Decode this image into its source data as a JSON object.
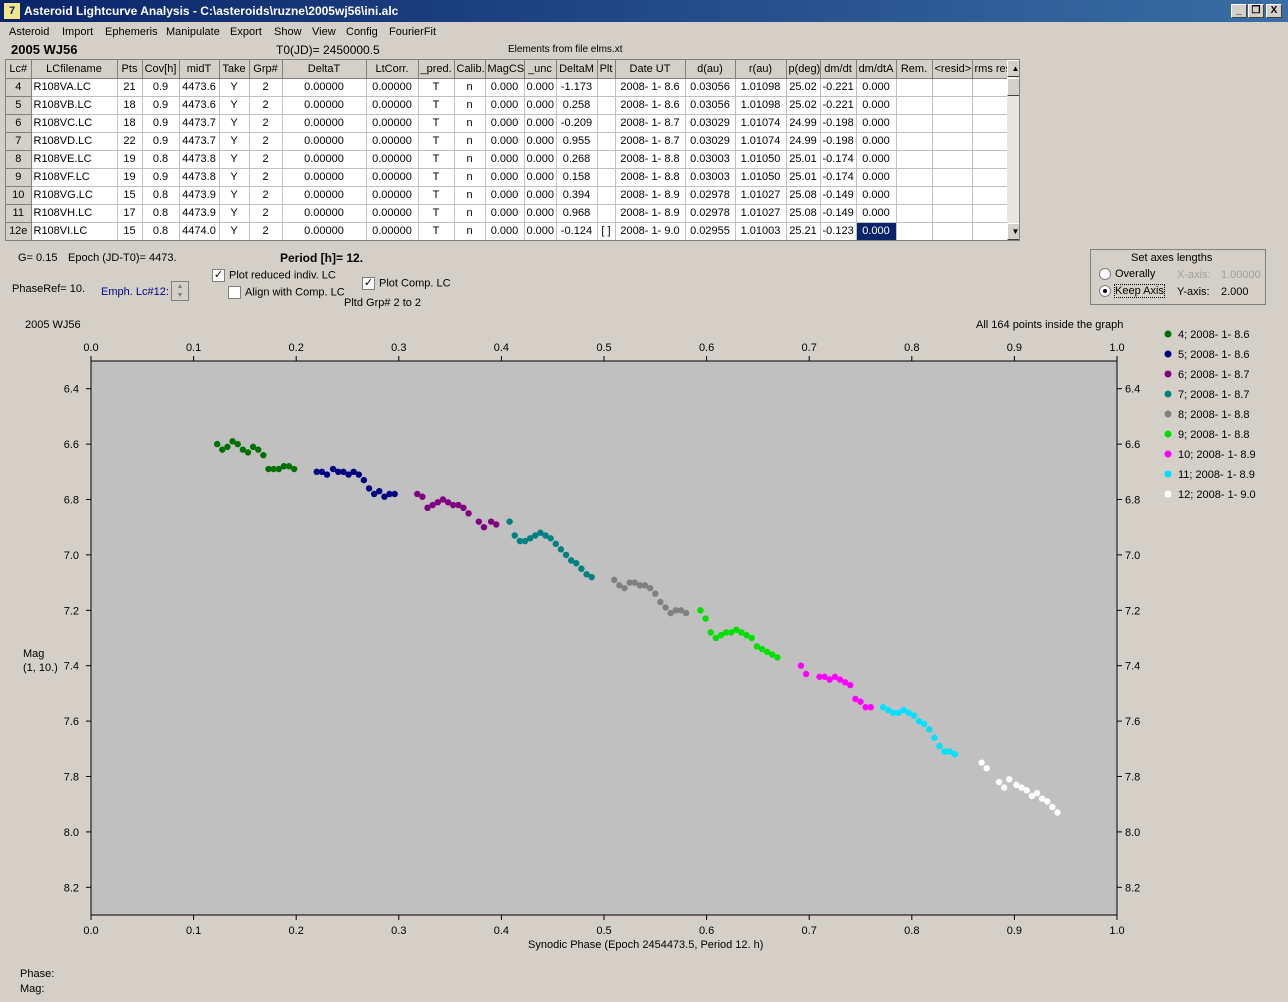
{
  "window": {
    "title": "Asteroid Lightcurve Analysis - C:\\asteroids\\ruzne\\2005wj56\\ini.alc",
    "icon_glyph": "7",
    "controls": {
      "minimize": "_",
      "restore": "❐",
      "close": "X"
    }
  },
  "menu": [
    "Asteroid",
    "Import",
    "Ephemeris",
    "Manipulate",
    "Export",
    "Show",
    "View",
    "Config",
    "FourierFit"
  ],
  "header": {
    "asteroid_name": "2005 WJ56",
    "t0": "T0(JD)= 2450000.5",
    "elements": "Elements from file elms.xt"
  },
  "table": {
    "columns": [
      "Lc#",
      "LCfilename",
      "Pts",
      "Cov[h]",
      "midT",
      "Take",
      "Grp#",
      "DeltaT",
      "LtCorr.",
      "_pred.",
      "Calib.",
      "MagCS",
      "_unc",
      "DeltaM",
      "Plt",
      "Date UT",
      "d(au)",
      "r(au)",
      "p(deg)",
      "dm/dt",
      "dm/dtA",
      "Rem.",
      "<resid>",
      "rms res"
    ],
    "rows": [
      [
        "4",
        "R108VA.LC",
        "21",
        "0.9",
        "4473.6",
        "Y",
        "2",
        "0.00000",
        "0.00000",
        "T",
        "n",
        "0.000",
        "0.000",
        "-1.173",
        "",
        "2008- 1- 8.6",
        "0.03056",
        "1.01098",
        "25.02",
        "-0.221",
        "0.000",
        "",
        "",
        ""
      ],
      [
        "5",
        "R108VB.LC",
        "18",
        "0.9",
        "4473.6",
        "Y",
        "2",
        "0.00000",
        "0.00000",
        "T",
        "n",
        "0.000",
        "0.000",
        "0.258",
        "",
        "2008- 1- 8.6",
        "0.03056",
        "1.01098",
        "25.02",
        "-0.221",
        "0.000",
        "",
        "",
        ""
      ],
      [
        "6",
        "R108VC.LC",
        "18",
        "0.9",
        "4473.7",
        "Y",
        "2",
        "0.00000",
        "0.00000",
        "T",
        "n",
        "0.000",
        "0.000",
        "-0.209",
        "",
        "2008- 1- 8.7",
        "0.03029",
        "1.01074",
        "24.99",
        "-0.198",
        "0.000",
        "",
        "",
        ""
      ],
      [
        "7",
        "R108VD.LC",
        "22",
        "0.9",
        "4473.7",
        "Y",
        "2",
        "0.00000",
        "0.00000",
        "T",
        "n",
        "0.000",
        "0.000",
        "0.955",
        "",
        "2008- 1- 8.7",
        "0.03029",
        "1.01074",
        "24.99",
        "-0.198",
        "0.000",
        "",
        "",
        ""
      ],
      [
        "8",
        "R108VE.LC",
        "19",
        "0.8",
        "4473.8",
        "Y",
        "2",
        "0.00000",
        "0.00000",
        "T",
        "n",
        "0.000",
        "0.000",
        "0.268",
        "",
        "2008- 1- 8.8",
        "0.03003",
        "1.01050",
        "25.01",
        "-0.174",
        "0.000",
        "",
        "",
        ""
      ],
      [
        "9",
        "R108VF.LC",
        "19",
        "0.9",
        "4473.8",
        "Y",
        "2",
        "0.00000",
        "0.00000",
        "T",
        "n",
        "0.000",
        "0.000",
        "0.158",
        "",
        "2008- 1- 8.8",
        "0.03003",
        "1.01050",
        "25.01",
        "-0.174",
        "0.000",
        "",
        "",
        ""
      ],
      [
        "10",
        "R108VG.LC",
        "15",
        "0.8",
        "4473.9",
        "Y",
        "2",
        "0.00000",
        "0.00000",
        "T",
        "n",
        "0.000",
        "0.000",
        "0.394",
        "",
        "2008- 1- 8.9",
        "0.02978",
        "1.01027",
        "25.08",
        "-0.149",
        "0.000",
        "",
        "",
        ""
      ],
      [
        "11",
        "R108VH.LC",
        "17",
        "0.8",
        "4473.9",
        "Y",
        "2",
        "0.00000",
        "0.00000",
        "T",
        "n",
        "0.000",
        "0.000",
        "0.968",
        "",
        "2008- 1- 8.9",
        "0.02978",
        "1.01027",
        "25.08",
        "-0.149",
        "0.000",
        "",
        "",
        ""
      ],
      [
        "12e",
        "R108VI.LC",
        "15",
        "0.8",
        "4474.0",
        "Y",
        "2",
        "0.00000",
        "0.00000",
        "T",
        "n",
        "0.000",
        "0.000",
        "-0.124",
        "[ ]",
        "2008- 1- 9.0",
        "0.02955",
        "1.01003",
        "25.21",
        "-0.123",
        "0.000",
        "",
        "",
        ""
      ]
    ]
  },
  "controls": {
    "g_value": "G= 0.15",
    "epoch": "Epoch (JD-T0)= 4473.",
    "period": "Period [h]= 12.",
    "phase_ref": "PhaseRef= 10.",
    "emph": "Emph. Lc#12:",
    "plot_reduced": "Plot reduced indiv. LC",
    "align_comp": "Align with Comp. LC",
    "plot_comp": "Plot Comp. LC",
    "pltd_grp": "Pltd Grp#  2   to   2",
    "check_mark": "✓"
  },
  "axes_box": {
    "title": "Set axes lengths",
    "overally": "Overally",
    "keep_axis": "Keep Axis",
    "x_label": "X-axis:",
    "x_value": "1.00000",
    "y_label": "Y-axis:",
    "y_value": "2.000"
  },
  "graph": {
    "top_left": "2005 WJ56",
    "top_right": "All 164 points inside the graph",
    "ylabel_line1": "Mag",
    "ylabel_line2": "(1, 10.)",
    "xlabel": "Synodic Phase (Epoch 2454473.5, Period 12. h)"
  },
  "chart_data": {
    "type": "scatter",
    "xlim": [
      0,
      1
    ],
    "ylim": [
      8.3,
      6.3
    ],
    "y_inverted": true,
    "x_ticks": [
      0.0,
      0.1,
      0.2,
      0.3,
      0.4,
      0.5,
      0.6,
      0.7,
      0.8,
      0.9,
      1.0
    ],
    "y_ticks": [
      6.4,
      6.6,
      6.8,
      7.0,
      7.2,
      7.4,
      7.6,
      7.8,
      8.0,
      8.2
    ],
    "legend_position": "right",
    "series": [
      {
        "name": "4; 2008- 1- 8.6",
        "color": "#007000",
        "x": [
          0.123,
          0.128,
          0.133,
          0.138,
          0.143,
          0.148,
          0.153,
          0.158,
          0.163,
          0.168,
          0.173,
          0.178,
          0.183,
          0.188,
          0.193,
          0.198
        ],
        "y": [
          6.6,
          6.62,
          6.61,
          6.59,
          6.6,
          6.62,
          6.63,
          6.61,
          6.62,
          6.64,
          6.69,
          6.69,
          6.69,
          6.68,
          6.68,
          6.69
        ]
      },
      {
        "name": "5; 2008- 1- 8.6",
        "color": "#000080",
        "x": [
          0.22,
          0.225,
          0.23,
          0.236,
          0.241,
          0.246,
          0.251,
          0.256,
          0.261,
          0.266,
          0.271,
          0.276,
          0.281,
          0.286,
          0.291,
          0.296
        ],
        "y": [
          6.7,
          6.7,
          6.71,
          6.69,
          6.7,
          6.7,
          6.71,
          6.7,
          6.71,
          6.73,
          6.76,
          6.78,
          6.77,
          6.79,
          6.78,
          6.78
        ]
      },
      {
        "name": "6; 2008- 1- 8.7",
        "color": "#800080",
        "x": [
          0.318,
          0.323,
          0.328,
          0.333,
          0.338,
          0.343,
          0.348,
          0.353,
          0.358,
          0.363,
          0.368,
          0.378,
          0.383,
          0.39,
          0.395
        ],
        "y": [
          6.78,
          6.79,
          6.83,
          6.82,
          6.81,
          6.8,
          6.81,
          6.82,
          6.82,
          6.83,
          6.85,
          6.88,
          6.9,
          6.88,
          6.89
        ]
      },
      {
        "name": "7; 2008- 1- 8.7",
        "color": "#008080",
        "x": [
          0.408,
          0.413,
          0.418,
          0.423,
          0.428,
          0.433,
          0.438,
          0.443,
          0.448,
          0.453,
          0.458,
          0.463,
          0.468,
          0.473,
          0.478,
          0.483,
          0.488
        ],
        "y": [
          6.88,
          6.93,
          6.95,
          6.95,
          6.94,
          6.93,
          6.92,
          6.93,
          6.94,
          6.96,
          6.98,
          7.0,
          7.02,
          7.03,
          7.05,
          7.07,
          7.08
        ]
      },
      {
        "name": "8; 2008- 1- 8.8",
        "color": "#808080",
        "x": [
          0.51,
          0.515,
          0.52,
          0.525,
          0.53,
          0.535,
          0.54,
          0.545,
          0.55,
          0.555,
          0.56,
          0.565,
          0.57,
          0.575,
          0.58
        ],
        "y": [
          7.09,
          7.11,
          7.12,
          7.1,
          7.1,
          7.11,
          7.11,
          7.12,
          7.14,
          7.17,
          7.19,
          7.21,
          7.2,
          7.2,
          7.21
        ]
      },
      {
        "name": "9; 2008- 1- 8.8",
        "color": "#00e000",
        "x": [
          0.594,
          0.599,
          0.604,
          0.609,
          0.614,
          0.619,
          0.624,
          0.629,
          0.634,
          0.639,
          0.644,
          0.649,
          0.654,
          0.659,
          0.664,
          0.669
        ],
        "y": [
          7.2,
          7.23,
          7.28,
          7.3,
          7.29,
          7.28,
          7.28,
          7.27,
          7.28,
          7.29,
          7.3,
          7.33,
          7.34,
          7.35,
          7.36,
          7.37
        ]
      },
      {
        "name": "10; 2008- 1- 8.9",
        "color": "#ff00ff",
        "x": [
          0.692,
          0.697,
          0.71,
          0.715,
          0.72,
          0.725,
          0.73,
          0.735,
          0.74,
          0.745,
          0.75,
          0.755,
          0.76
        ],
        "y": [
          7.4,
          7.43,
          7.44,
          7.44,
          7.45,
          7.44,
          7.45,
          7.46,
          7.47,
          7.52,
          7.53,
          7.55,
          7.55
        ]
      },
      {
        "name": "11; 2008- 1- 8.9",
        "color": "#00e0ff",
        "x": [
          0.772,
          0.777,
          0.782,
          0.787,
          0.792,
          0.797,
          0.802,
          0.807,
          0.812,
          0.817,
          0.822,
          0.827,
          0.832,
          0.837,
          0.842
        ],
        "y": [
          7.55,
          7.56,
          7.57,
          7.57,
          7.56,
          7.57,
          7.58,
          7.6,
          7.61,
          7.63,
          7.66,
          7.69,
          7.71,
          7.71,
          7.72
        ]
      },
      {
        "name": "12; 2008- 1- 9.0",
        "color": "#ffffff",
        "x": [
          0.868,
          0.873,
          0.885,
          0.89,
          0.895,
          0.902,
          0.907,
          0.912,
          0.917,
          0.922,
          0.927,
          0.932,
          0.937,
          0.942
        ],
        "y": [
          7.75,
          7.77,
          7.82,
          7.84,
          7.81,
          7.83,
          7.84,
          7.85,
          7.87,
          7.86,
          7.88,
          7.89,
          7.91,
          7.93
        ]
      }
    ]
  },
  "status": {
    "phase_label": "Phase:",
    "mag_label": "Mag:"
  }
}
